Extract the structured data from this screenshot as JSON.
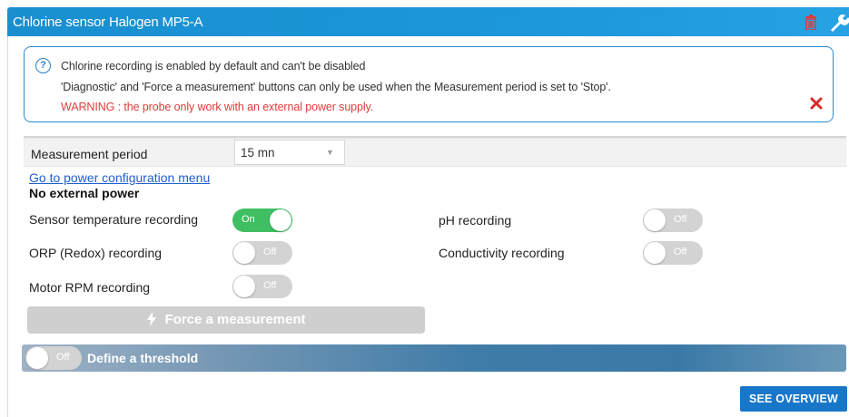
{
  "header": {
    "title": "Chlorine sensor Halogen MP5-A",
    "icons": [
      "trash-icon",
      "wrench-icon"
    ]
  },
  "info": {
    "line1": "Chlorine recording is enabled by default and can't be disabled",
    "line2": "'Diagnostic' and 'Force a measurement' buttons can only be used when the Measurement period is set to 'Stop'.",
    "warning": "WARNING : the probe only work with an external power supply.",
    "icons": [
      "help-icon",
      "close-icon"
    ]
  },
  "measurement": {
    "label": "Measurement period",
    "value": "15 mn"
  },
  "power": {
    "link": "Go to power configuration menu",
    "status": "No external power"
  },
  "recordings": [
    {
      "label": "Sensor temperature recording",
      "state": "On"
    },
    {
      "label": "pH recording",
      "state": "Off"
    },
    {
      "label": "ORP (Redox) recording",
      "state": "Off"
    },
    {
      "label": "Conductivity recording",
      "state": "Off"
    },
    {
      "label": "Motor RPM recording",
      "state": "Off"
    }
  ],
  "force_button": "Force a measurement",
  "threshold": {
    "state": "Off",
    "label": "Define a threshold"
  },
  "overview_button": "SEE OVERVIEW",
  "colors": {
    "header": "#1c97d8",
    "toggle_on": "#3fbf62",
    "toggle_off": "#d3d3d3",
    "warning": "#e13b3b",
    "link": "#1f5fcf",
    "button": "#1877c9"
  }
}
